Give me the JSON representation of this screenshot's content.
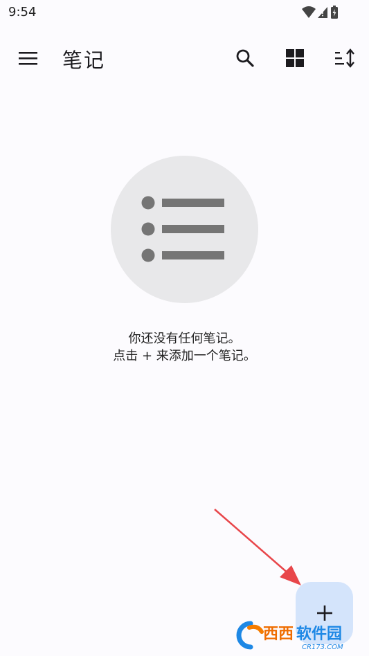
{
  "status_bar": {
    "time": "9:54",
    "icons": [
      "wifi-icon",
      "signal-icon",
      "battery-icon"
    ]
  },
  "app_bar": {
    "title": "笔记",
    "icons": [
      "menu-icon",
      "search-icon",
      "grid-view-icon",
      "sort-icon"
    ]
  },
  "empty_state": {
    "line1": "你还没有任何笔记。",
    "line2": "点击 + 来添加一个笔记。",
    "icon": "list-icon"
  },
  "fab": {
    "label": "+",
    "icon": "add-icon"
  },
  "colors": {
    "background": "#fcfbfe",
    "fab": "#d4e4fb",
    "annotation_arrow": "#e8464a"
  },
  "watermark": {
    "brand": "Cr 西西软件园",
    "domain": "CR173.COM"
  }
}
